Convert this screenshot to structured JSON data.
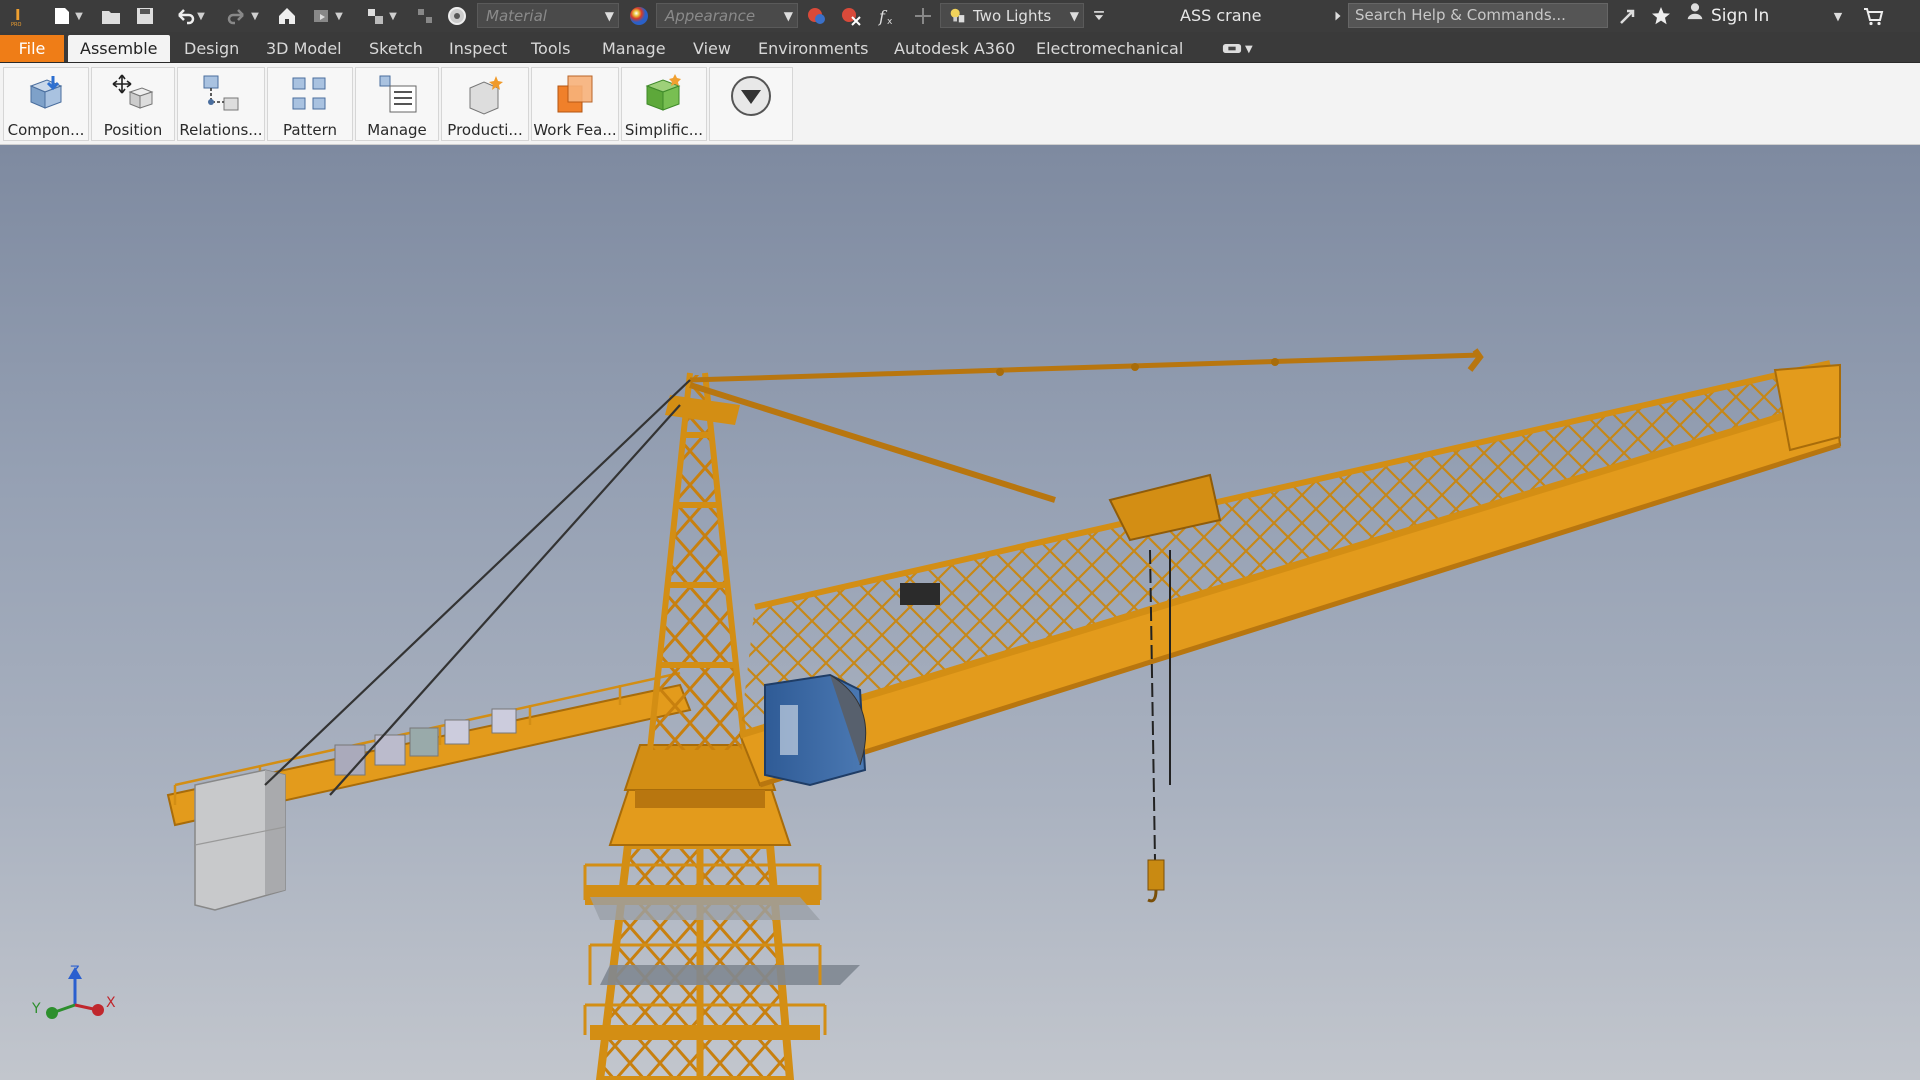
{
  "quick_access": {
    "material_placeholder": "Material",
    "appearance_placeholder": "Appearance",
    "lighting_style": "Two Lights",
    "document_title": "ASS crane",
    "search_placeholder": "Search Help & Commands...",
    "sign_in": "Sign In",
    "icons": [
      "app-logo-icon",
      "new-icon",
      "open-icon",
      "save-icon",
      "undo-icon",
      "redo-icon",
      "home-icon",
      "update-icon",
      "select-icon",
      "measure-icon",
      "color-wheel-icon",
      "appearance-adjust-icon",
      "clear-appearance-icon",
      "function-icon",
      "plus-icon",
      "lightbulb-icon",
      "customize-icon",
      "exchange-icon",
      "favorites-star-icon",
      "user-icon",
      "cart-icon"
    ]
  },
  "tabs": [
    {
      "label": "File"
    },
    {
      "label": "Assemble"
    },
    {
      "label": "Design"
    },
    {
      "label": "3D Model"
    },
    {
      "label": "Sketch"
    },
    {
      "label": "Inspect"
    },
    {
      "label": "Tools"
    },
    {
      "label": "Manage"
    },
    {
      "label": "View"
    },
    {
      "label": "Environments"
    },
    {
      "label": "Autodesk A360"
    },
    {
      "label": "Electromechanical"
    }
  ],
  "ribbon": {
    "buttons": [
      {
        "label": "Compon..."
      },
      {
        "label": "Position"
      },
      {
        "label": "Relations..."
      },
      {
        "label": "Pattern"
      },
      {
        "label": "Manage"
      },
      {
        "label": "Producti..."
      },
      {
        "label": "Work Fea..."
      },
      {
        "label": "Simplific..."
      }
    ]
  },
  "viewport": {
    "axes": {
      "z": "Z",
      "y": "Y",
      "x": "X"
    }
  },
  "colors": {
    "crane_yellow": "#e39b1c",
    "crane_dark": "#b8760f",
    "file_tab": "#ef7d17",
    "cab_blue": "#3d68a3"
  }
}
